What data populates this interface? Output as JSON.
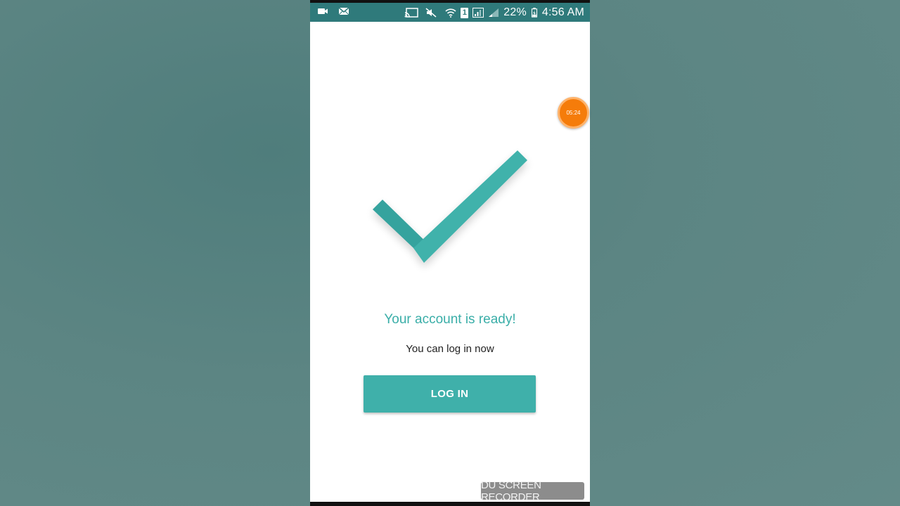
{
  "status_bar": {
    "left_icons": [
      "video-camera-icon",
      "mail-icon"
    ],
    "right_icons": [
      "cast-icon",
      "mute-icon",
      "wifi-icon",
      "sim-icon",
      "signal-icon",
      "signal-weak-icon",
      "battery-icon"
    ],
    "sim_label": "1",
    "battery_percent": "22%",
    "time": "4:56 AM"
  },
  "success": {
    "icon": "checkmark-icon",
    "title": "Your account is ready!",
    "subtitle": "You can log in now"
  },
  "actions": {
    "login_label": "LOG IN"
  },
  "overlay": {
    "timer": "05:24",
    "watermark": "DU SCREEN RECORDER"
  },
  "colors": {
    "accent": "#3fb0aa",
    "status_bar": "#2f7a7b",
    "timer": "#f57c0a",
    "backdrop": "#5c8583"
  }
}
